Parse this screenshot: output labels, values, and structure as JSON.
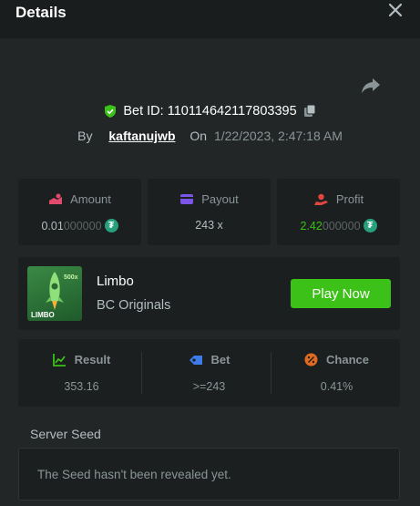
{
  "header": {
    "title": "Details"
  },
  "bet": {
    "id_label": "Bet ID: 110114642117803395",
    "by_label": "By",
    "username": "kaftanujwb",
    "on_label": "On",
    "date": "1/22/2023, 2:47:18 AM"
  },
  "stats": {
    "amount": {
      "label": "Amount",
      "value_main": "0.01",
      "value_dim": "000000"
    },
    "payout": {
      "label": "Payout",
      "value": "243 x"
    },
    "profit": {
      "label": "Profit",
      "value_main": "2.42",
      "value_dim": "000000"
    }
  },
  "game": {
    "name": "Limbo",
    "provider": "BC Originals",
    "play_label": "Play Now",
    "thumb_text": "LIMBO",
    "thumb_badge": "500x"
  },
  "result": {
    "result": {
      "label": "Result",
      "value": "353.16"
    },
    "bet": {
      "label": "Bet",
      "value": ">=243"
    },
    "chance": {
      "label": "Chance",
      "value": "0.41%"
    }
  },
  "seed": {
    "label": "Server Seed",
    "message": "The Seed hasn't been revealed yet."
  },
  "colors": {
    "accent_green": "#3bc117",
    "amount_pink": "#e04a6c",
    "payout_purple": "#7b54e8",
    "profit_red": "#e0463f",
    "bet_blue": "#3d7be8",
    "chance_orange": "#e06a1f",
    "usdt_teal": "#26a17b"
  }
}
